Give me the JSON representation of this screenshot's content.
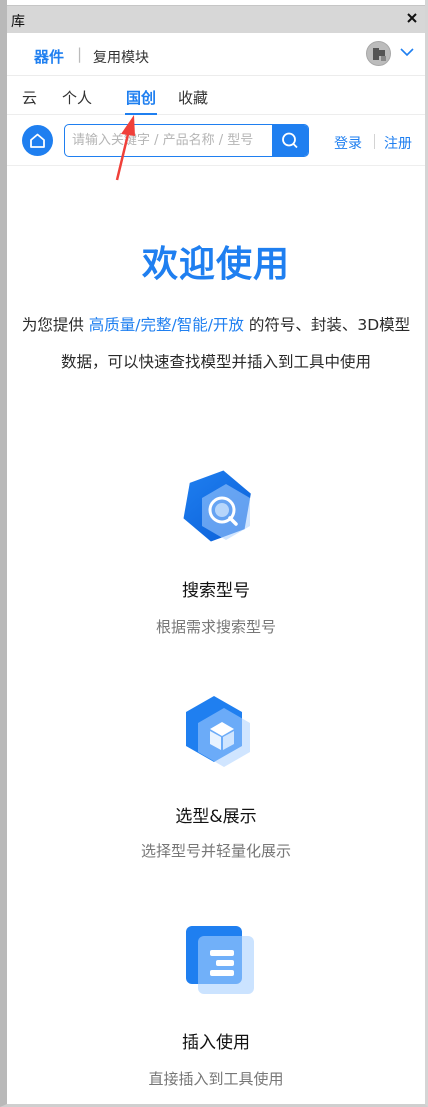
{
  "window": {
    "title": "库"
  },
  "header": {
    "segment_active": "器件",
    "segment_separator": "|",
    "segment_other": "复用模块"
  },
  "tabs": [
    {
      "label": "云",
      "active": false
    },
    {
      "label": "个人",
      "active": false
    },
    {
      "label": "国创",
      "active": true
    },
    {
      "label": "收藏",
      "active": false
    }
  ],
  "search": {
    "placeholder": "请输入关键字 / 产品名称 / 型号",
    "value": ""
  },
  "auth": {
    "login": "登录",
    "register": "注册"
  },
  "welcome": {
    "title": "欢迎使用",
    "intro_prefix": "为您提供 ",
    "intro_highlight": "高质量/完整/智能/开放",
    "intro_suffix": " 的符号、封装、3D模型数据，可以快速查找模型并插入到工具中使用"
  },
  "features": [
    {
      "icon": "search-hexagon-icon",
      "title": "搜索型号",
      "desc": "根据需求搜索型号"
    },
    {
      "icon": "cube-hexagon-icon",
      "title": "选型&展示",
      "desc": "选择型号并轻量化展示"
    },
    {
      "icon": "insert-blocks-icon",
      "title": "插入使用",
      "desc": "直接插入到工具使用"
    }
  ],
  "colors": {
    "accent": "#1f7ff0",
    "annotation_arrow": "#f0403a"
  }
}
